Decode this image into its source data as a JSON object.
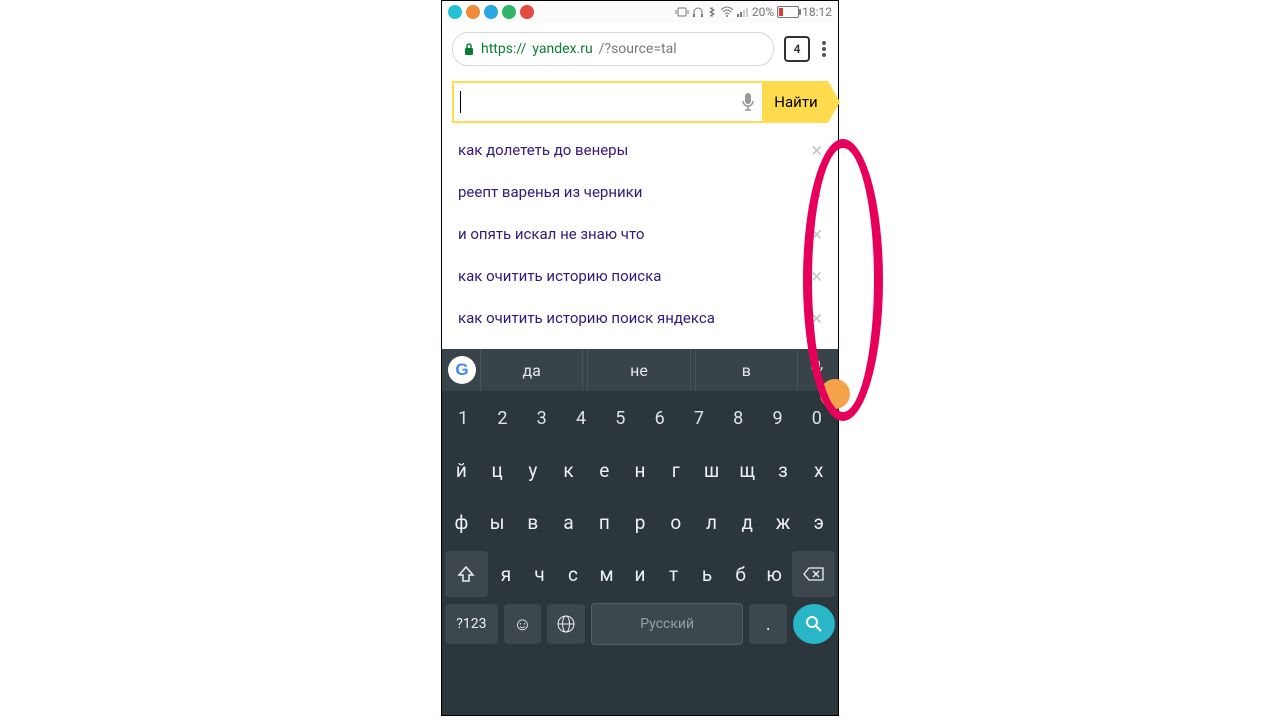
{
  "statusbar": {
    "battery_pct": "20%",
    "time": "18:12",
    "app_dots": [
      "#27c1d6",
      "#f08b3c",
      "#2aa7e0",
      "#2fb46a",
      "#e44a3f"
    ]
  },
  "browser": {
    "protocol": "https://",
    "host": "yandex.ru",
    "path": "/?source=tal",
    "tab_count": "4"
  },
  "search": {
    "value": "",
    "button_label": "Найти"
  },
  "suggestions": [
    "как долететь до венеры",
    "реепт варенья из черники",
    "и опять искал не знаю что",
    "как очитить историю поиска",
    "как очитить историю поиск яндекса"
  ],
  "gboard": {
    "predictions": [
      "да",
      "не",
      "в"
    ],
    "space_label": "Русский",
    "symbol_key": "?123"
  },
  "keyboard": {
    "row_num": [
      "1",
      "2",
      "3",
      "4",
      "5",
      "6",
      "7",
      "8",
      "9",
      "0"
    ],
    "row1": [
      "й",
      "ц",
      "у",
      "к",
      "е",
      "н",
      "г",
      "ш",
      "щ",
      "з",
      "х"
    ],
    "row2": [
      "ф",
      "ы",
      "в",
      "а",
      "п",
      "р",
      "о",
      "л",
      "д",
      "ж",
      "э"
    ],
    "row3": [
      "я",
      "ч",
      "с",
      "м",
      "и",
      "т",
      "ь",
      "б",
      "ю"
    ]
  }
}
